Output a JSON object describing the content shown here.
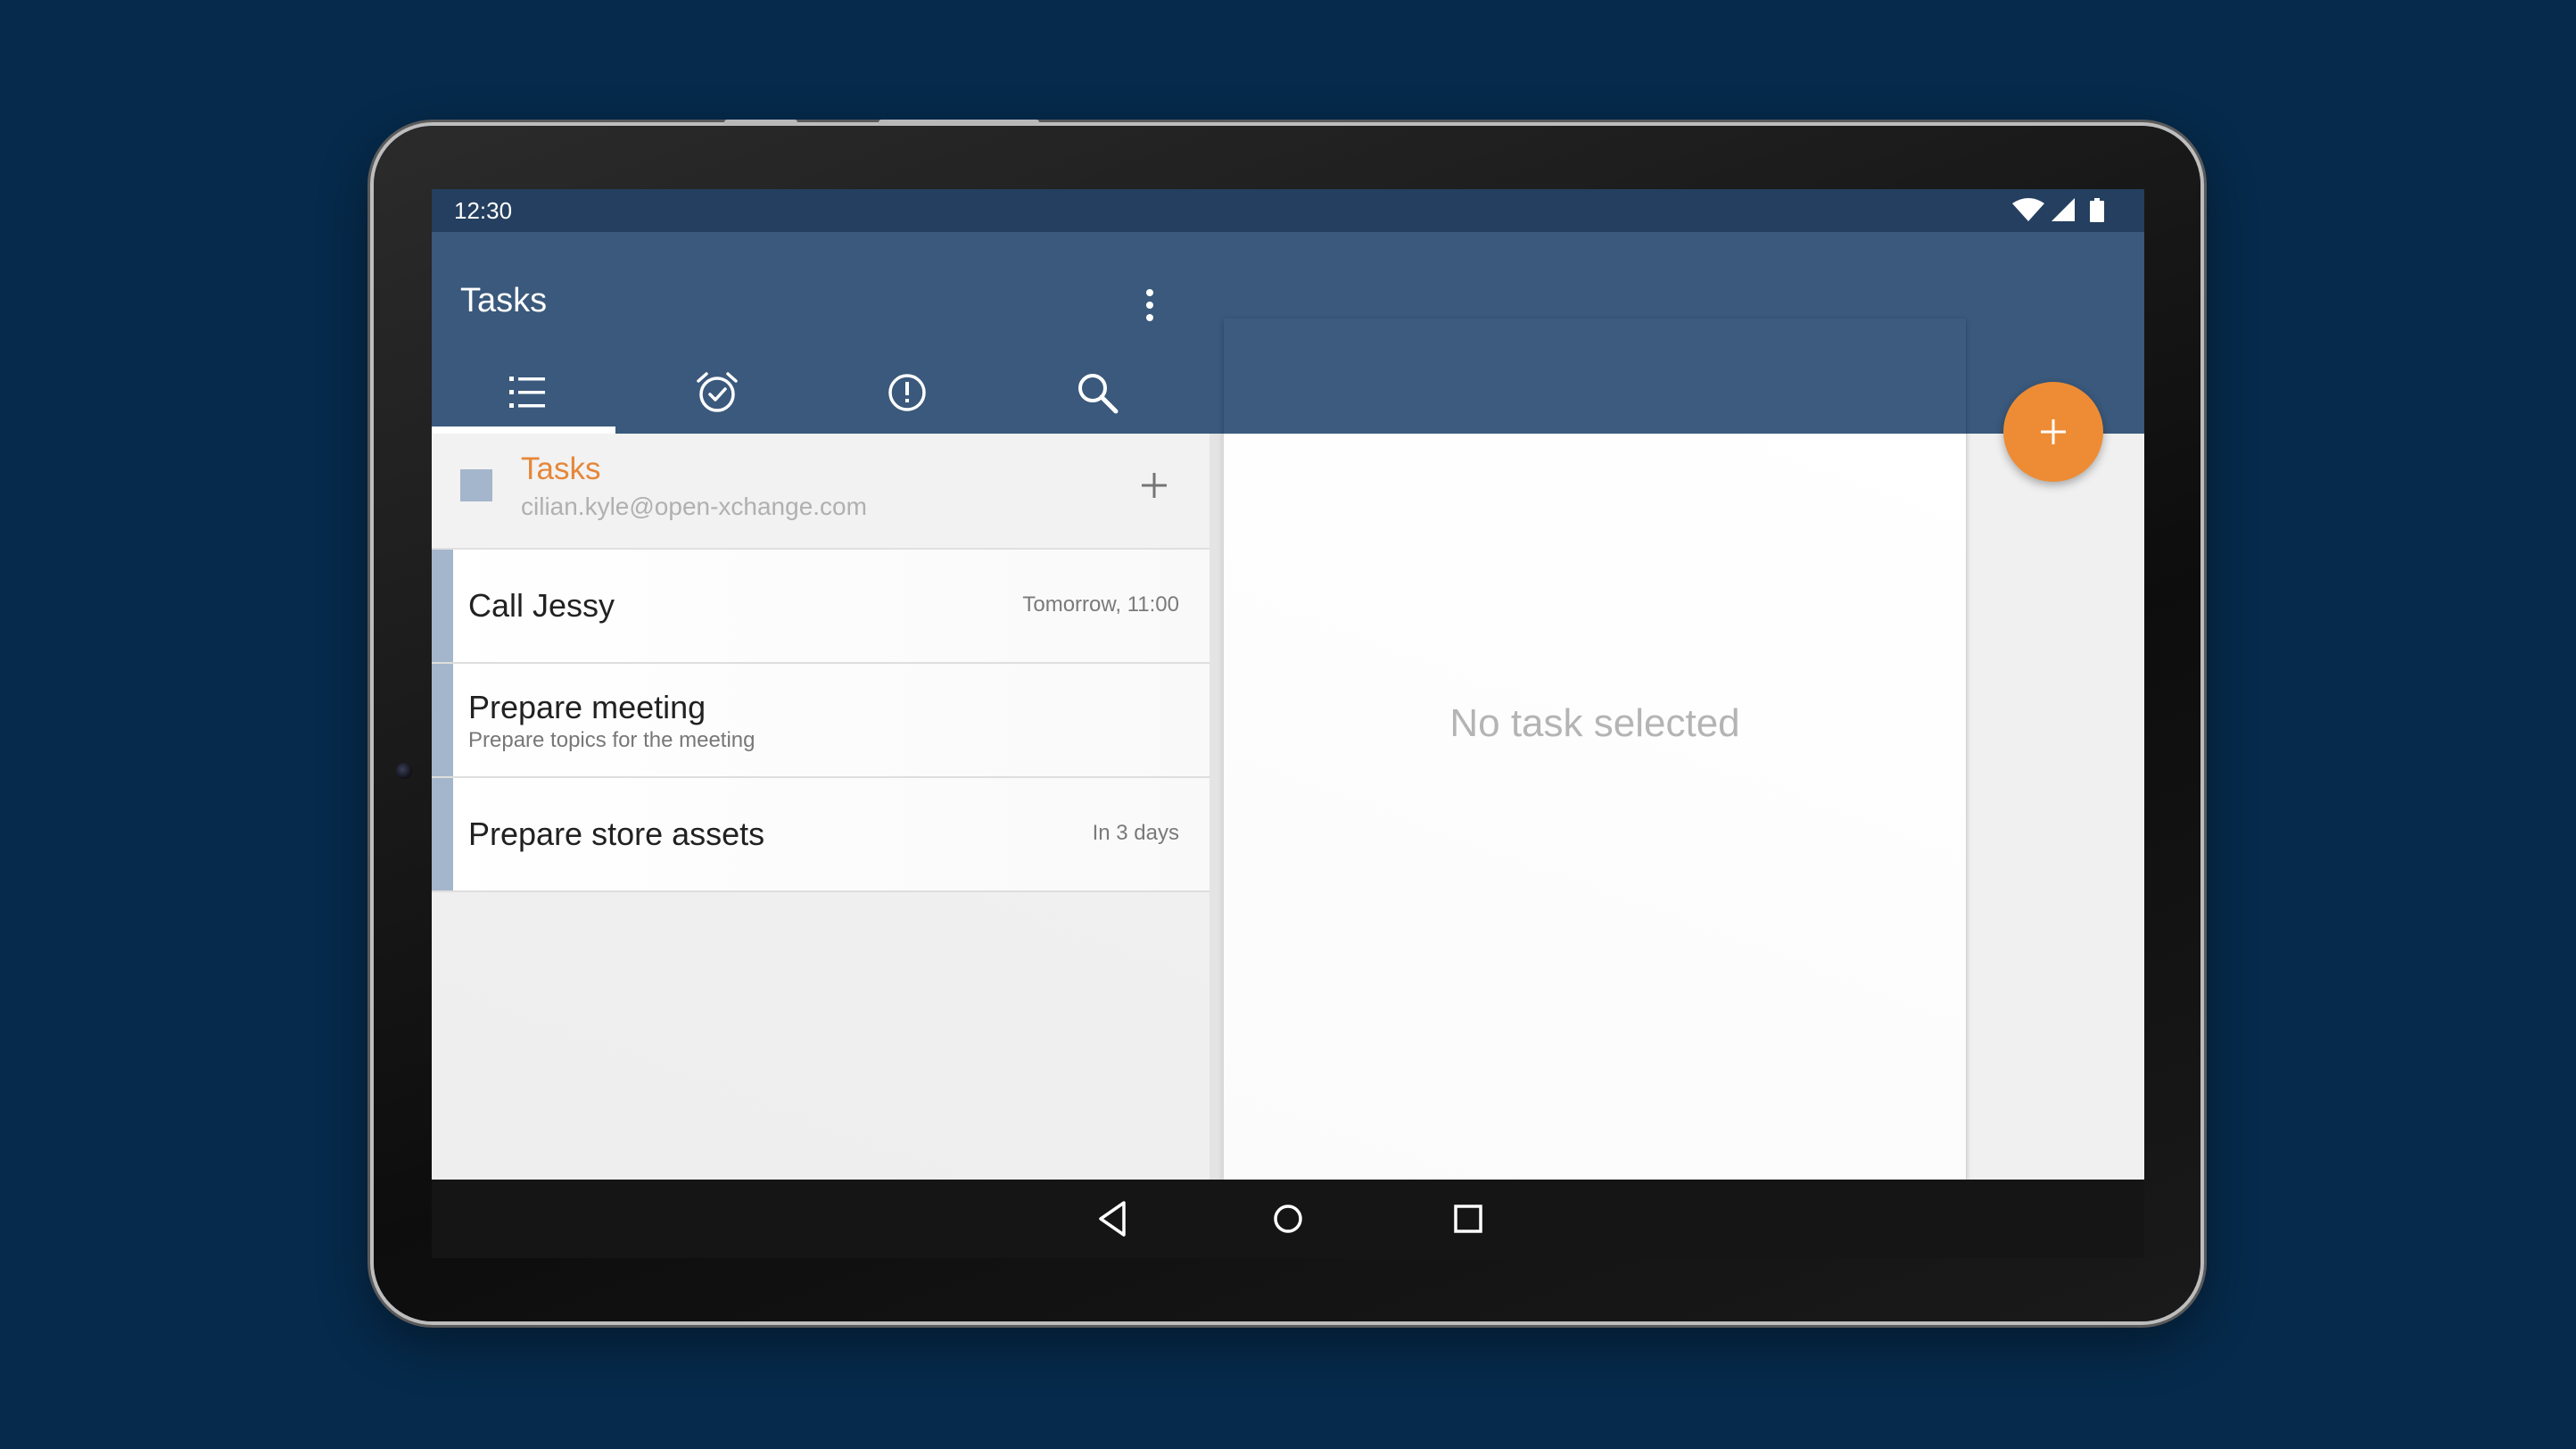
{
  "status_bar": {
    "time": "12:30",
    "icons": [
      "wifi-icon",
      "cellular-signal-icon",
      "battery-icon"
    ]
  },
  "app_bar": {
    "title": "Tasks",
    "overflow_icon": "more-vert-icon"
  },
  "tabs": [
    {
      "name": "all-tasks",
      "icon": "list-icon",
      "selected": true
    },
    {
      "name": "due",
      "icon": "alarm-check-icon",
      "selected": false
    },
    {
      "name": "important",
      "icon": "alert-circle-icon",
      "selected": false
    },
    {
      "name": "search",
      "icon": "search-icon",
      "selected": false
    }
  ],
  "folder": {
    "name": "Tasks",
    "account": "cilian.kyle@open-xchange.com",
    "add_icon": "plus-icon"
  },
  "tasks": [
    {
      "title": "Call Jessy",
      "subtitle": "",
      "due": "Tomorrow, 11:00"
    },
    {
      "title": "Prepare meeting",
      "subtitle": "Prepare topics for the meeting",
      "due": ""
    },
    {
      "title": "Prepare store assets",
      "subtitle": "",
      "due": "In 3 days"
    }
  ],
  "detail": {
    "empty_text": "No task selected"
  },
  "fab": {
    "icon": "plus-icon"
  },
  "nav_bar": {
    "buttons": [
      "back-icon",
      "home-icon",
      "recents-icon"
    ]
  },
  "colors": {
    "page_background": "#062a4b",
    "status_bar": "#243f5f",
    "app_bar": "#3a597c",
    "accent": "#ee8c35",
    "folder_name": "#e5873a",
    "task_accent": "#a4b6cb"
  }
}
